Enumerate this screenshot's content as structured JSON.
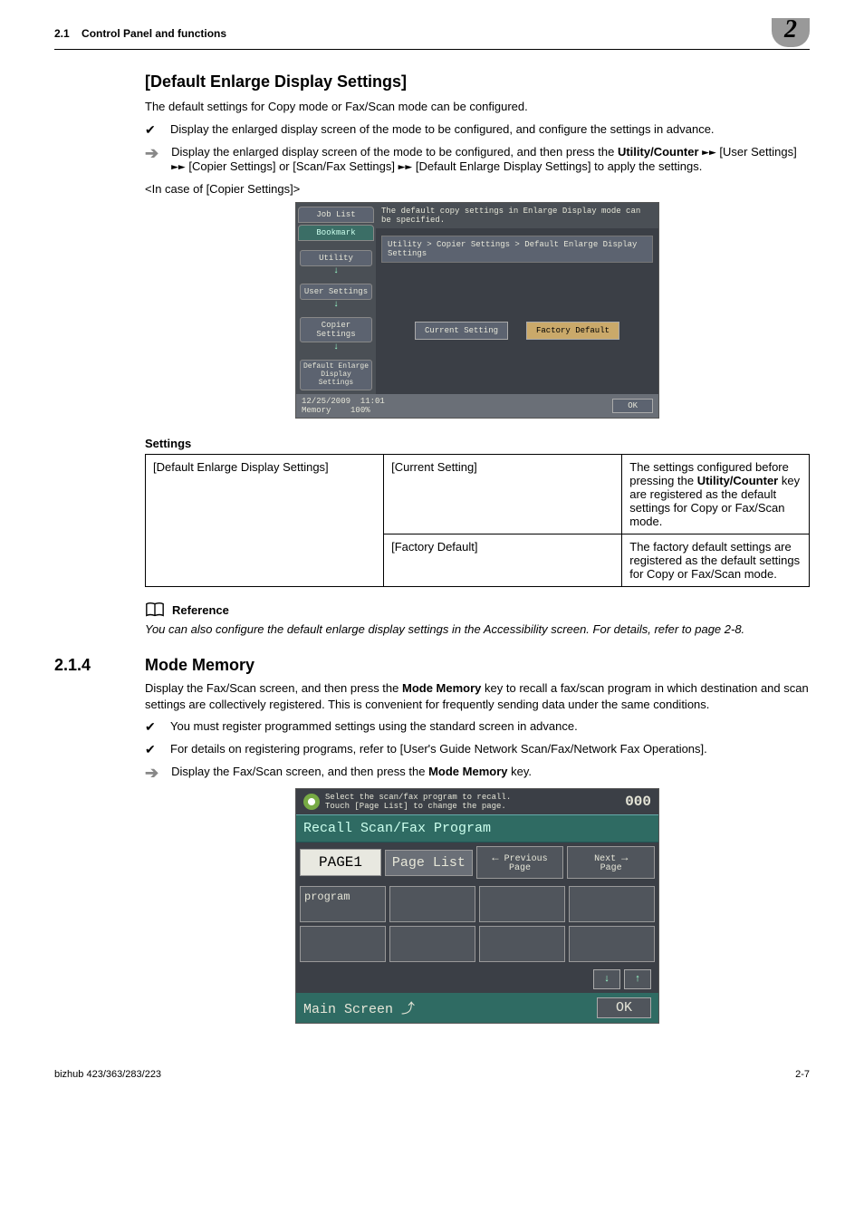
{
  "header": {
    "section_num": "2.1",
    "section_title": "Control Panel and functions",
    "chapter_badge": "2"
  },
  "main": {
    "h2": "[Default Enlarge Display Settings]",
    "intro": "The default settings for Copy mode or Fax/Scan mode can be configured.",
    "check1": "Display the enlarged display screen of the mode to be configured, and configure the settings in advance.",
    "arrow1_a": "Display the enlarged display screen of the mode to be configured, and then press the ",
    "arrow1_b": "Utility/Counter",
    "arrow1_c": " [User Settings] ",
    "arrow1_d": " [Copier Settings] or [Scan/Fax Settings] ",
    "arrow1_e": " [Default Enlarge Display Settings] to apply the settings.",
    "caption1": "<In case of [Copier Settings]>"
  },
  "shot1": {
    "tab1": "Job List",
    "tab2": "Bookmark",
    "crumb1": "Utility",
    "crumb2": "User Settings",
    "crumb3": "Copier Settings",
    "crumb4": "Default Enlarge Display Settings",
    "msg": "The default copy settings in Enlarge Display mode can be specified.",
    "path": "Utility > Copier Settings > Default Enlarge Display Settings",
    "btn1": "Current Setting",
    "btn2": "Factory Default",
    "date": "12/25/2009",
    "time": "11:01",
    "mem_lbl": "Memory",
    "mem_val": "100%",
    "ok": "OK"
  },
  "table": {
    "title": "Settings",
    "r1c1": "[Default Enlarge Display Settings]",
    "r1c2": "[Current Setting]",
    "r1c3_a": "The settings configured before pressing the ",
    "r1c3_b": "Utility/Counter",
    "r1c3_c": " key are registered as the default settings for Copy or Fax/Scan mode.",
    "r2c2": "[Factory Default]",
    "r2c3": "The factory default settings are registered as the default settings for Copy or Fax/Scan mode."
  },
  "reference": {
    "label": "Reference",
    "text": "You can also configure the default enlarge display settings in the Accessibility screen. For details, refer to page 2-8."
  },
  "sec214": {
    "num": "2.1.4",
    "title": "Mode Memory",
    "p1_a": "Display the Fax/Scan screen, and then press the ",
    "p1_b": "Mode Memory",
    "p1_c": " key to recall a fax/scan program in which destination and scan settings are collectively registered. This is convenient for frequently sending data under the same conditions.",
    "check1": "You must register programmed settings using the standard screen in advance.",
    "check2": "For details on registering programs, refer to [User's Guide Network Scan/Fax/Network Fax Operations].",
    "arrow_a": "Display the Fax/Scan screen, and then press the ",
    "arrow_b": "Mode Memory",
    "arrow_c": " key."
  },
  "shot2": {
    "msg1": "Select the scan/fax program to recall.",
    "msg2": "Touch [Page List] to change the page.",
    "count": "000",
    "bar": "Recall Scan/Fax Program",
    "page": "PAGE1",
    "pagelist": "Page List",
    "prev": "Previous Page",
    "next": "Next Page",
    "cell1": "program",
    "main": "Main Screen",
    "ok": "OK"
  },
  "footer": {
    "left": "bizhub 423/363/283/223",
    "right": "2-7"
  }
}
